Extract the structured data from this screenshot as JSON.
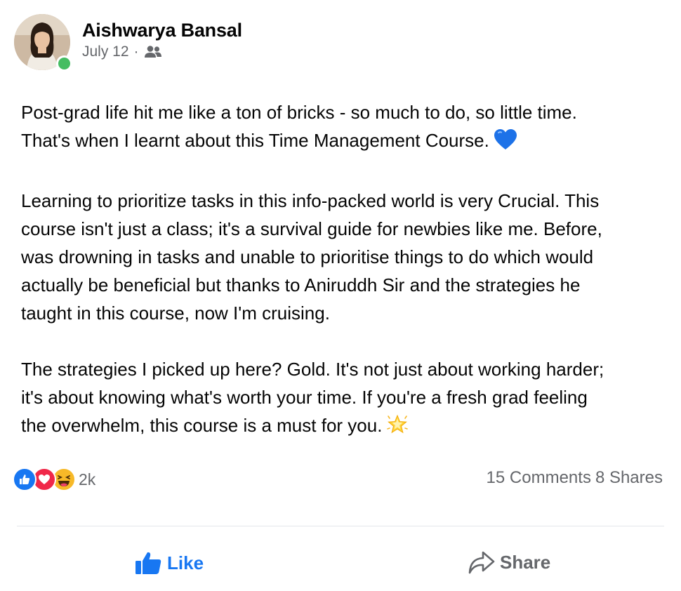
{
  "post": {
    "author": "Aishwarya Bansal",
    "date": "July 12",
    "separator": "·",
    "audience_icon": "friends-icon",
    "online": true,
    "paragraphs": [
      "Post-grad life hit me like a ton of bricks - so much to do, so little time.\nThat's when I learnt about this Time Management Course.",
      "Learning to prioritize tasks in this info-packed world is very Crucial. This\ncourse isn't just a class; it's a survival guide for newbies like me. Before,\nwas drowning in tasks and unable to prioritise things to do which would\nactually be beneficial but thanks to Aniruddh Sir and the strategies he\ntaught in this course, now I'm cruising.",
      "The strategies I picked up here? Gold. It's not just about working harder;\nit's about knowing what's worth your time. If you're a fresh grad feeling\nthe overwhelm, this course is a must for you."
    ],
    "paragraph_emojis": [
      "blue-heart-icon",
      null,
      "glowing-star-icon"
    ]
  },
  "stats": {
    "reactions": [
      "like-reaction-icon",
      "love-reaction-icon",
      "haha-reaction-icon"
    ],
    "reaction_count": "2k",
    "comments": "15 Comments",
    "shares": "8 Shares"
  },
  "actions": {
    "like_label": "Like",
    "share_label": "Share"
  },
  "colors": {
    "accent": "#1877f2",
    "secondary_text": "#65676b",
    "online": "#45bd62",
    "love": "#f02849",
    "haha": "#f7b928"
  }
}
